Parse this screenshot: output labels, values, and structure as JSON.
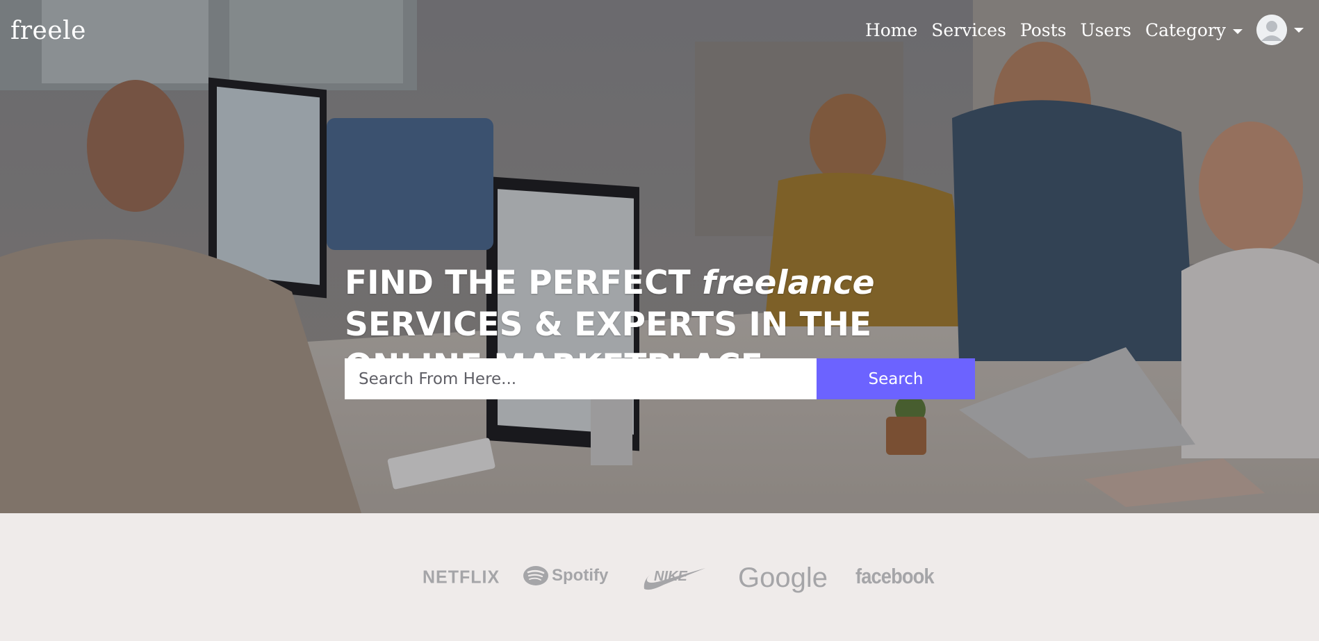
{
  "brand": {
    "name": "freele"
  },
  "nav": {
    "items": [
      {
        "label": "Home"
      },
      {
        "label": "Services"
      },
      {
        "label": "Posts"
      },
      {
        "label": "Users"
      }
    ],
    "category": {
      "label": "Category"
    },
    "user_menu": {
      "icon": "user-avatar-icon"
    }
  },
  "hero": {
    "headline_part1": "FIND THE PERFECT ",
    "headline_emphasis": "freelance",
    "headline_part2": " SERVICES & EXPERTS IN THE ONLINE MARKETPLACE"
  },
  "search": {
    "placeholder": "Search From Here...",
    "value": "",
    "button_label": "Search"
  },
  "logos": {
    "netflix": "NETFLIX",
    "spotify": "Spotify",
    "nike": "NIKE",
    "google": "Google",
    "facebook": "facebook"
  },
  "colors": {
    "accent": "#6c63ff",
    "logo_gray": "#a5a5a8",
    "strip_background": "#efebea",
    "nav_text": "#ffffff"
  }
}
